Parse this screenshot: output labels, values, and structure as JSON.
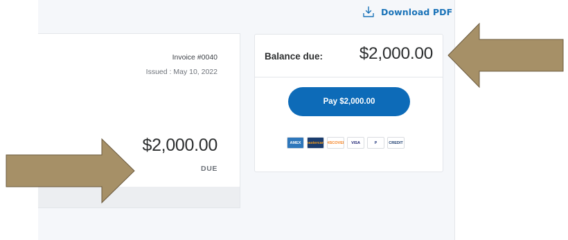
{
  "toolbar": {
    "download_label": "Download PDF"
  },
  "invoice": {
    "number": "Invoice #0040",
    "issued": "Issued : May 10, 2022",
    "amount": "$2,000.00",
    "status": "DUE"
  },
  "balance": {
    "label": "Balance due:",
    "amount": "$2,000.00",
    "pay_button_label": "Pay $2,000.00"
  },
  "payment_methods": [
    {
      "name": "amex-icon",
      "label": "AMEX",
      "bg": "#2e77bb",
      "fg": "#ffffff"
    },
    {
      "name": "mastercard-icon",
      "label": "mastercard",
      "bg": "#1a3c6e",
      "fg": "#f79e1b"
    },
    {
      "name": "discover-icon",
      "label": "DISCOVER",
      "bg": "#ffffff",
      "fg": "#f58220"
    },
    {
      "name": "visa-icon",
      "label": "VISA",
      "bg": "#ffffff",
      "fg": "#1a1f71"
    },
    {
      "name": "paypal-icon",
      "label": "P",
      "bg": "#ffffff",
      "fg": "#253b80"
    },
    {
      "name": "paypal-credit-icon",
      "label": "CREDIT",
      "bg": "#ffffff",
      "fg": "#1a3c6e"
    }
  ],
  "colors": {
    "accent": "#0d6bb8",
    "link": "#1a73b8",
    "annotation_arrow": "#a69067"
  }
}
